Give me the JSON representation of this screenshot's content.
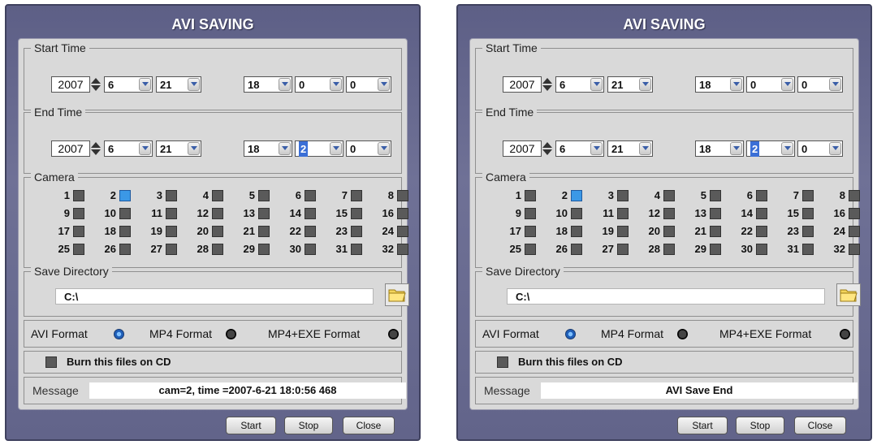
{
  "dialogs": [
    {
      "title": "AVI SAVING",
      "start": {
        "label": "Start Time",
        "year": "2007",
        "month": "6",
        "day": "21",
        "hour": "18",
        "minute": "0",
        "second": "0"
      },
      "end": {
        "label": "End Time",
        "year": "2007",
        "month": "6",
        "day": "21",
        "hour": "18",
        "minute": "2",
        "second": "0"
      },
      "camera": {
        "label": "Camera",
        "selected": 2
      },
      "save": {
        "label": "Save Directory",
        "path": "C:\\"
      },
      "formats": [
        "AVI Format",
        "MP4 Format",
        "MP4+EXE Format"
      ],
      "format_selected": "AVI Format",
      "burn_label": "Burn this files on CD",
      "message_label": "Message",
      "message": "cam=2, time =2007-6-21 18:0:56  468",
      "buttons": [
        "Start",
        "Stop",
        "Close"
      ]
    },
    {
      "title": "AVI SAVING",
      "start": {
        "label": "Start Time",
        "year": "2007",
        "month": "6",
        "day": "21",
        "hour": "18",
        "minute": "0",
        "second": "0"
      },
      "end": {
        "label": "End Time",
        "year": "2007",
        "month": "6",
        "day": "21",
        "hour": "18",
        "minute": "2",
        "second": "0"
      },
      "camera": {
        "label": "Camera",
        "selected": 2
      },
      "save": {
        "label": "Save Directory",
        "path": "C:\\"
      },
      "formats": [
        "AVI Format",
        "MP4 Format",
        "MP4+EXE Format"
      ],
      "format_selected": "AVI Format",
      "burn_label": "Burn this files on CD",
      "message_label": "Message",
      "message": "AVI Save End",
      "buttons": [
        "Start",
        "Stop",
        "Close"
      ]
    }
  ],
  "cameras": [
    "1",
    "2",
    "3",
    "4",
    "5",
    "6",
    "7",
    "8",
    "9",
    "10",
    "11",
    "12",
    "13",
    "14",
    "15",
    "16",
    "17",
    "18",
    "19",
    "20",
    "21",
    "22",
    "23",
    "24",
    "25",
    "26",
    "27",
    "28",
    "29",
    "30",
    "31",
    "32"
  ],
  "colors": {
    "frame": "#62648a",
    "panel": "#d9d9d9",
    "checked": "#3b98e6"
  }
}
